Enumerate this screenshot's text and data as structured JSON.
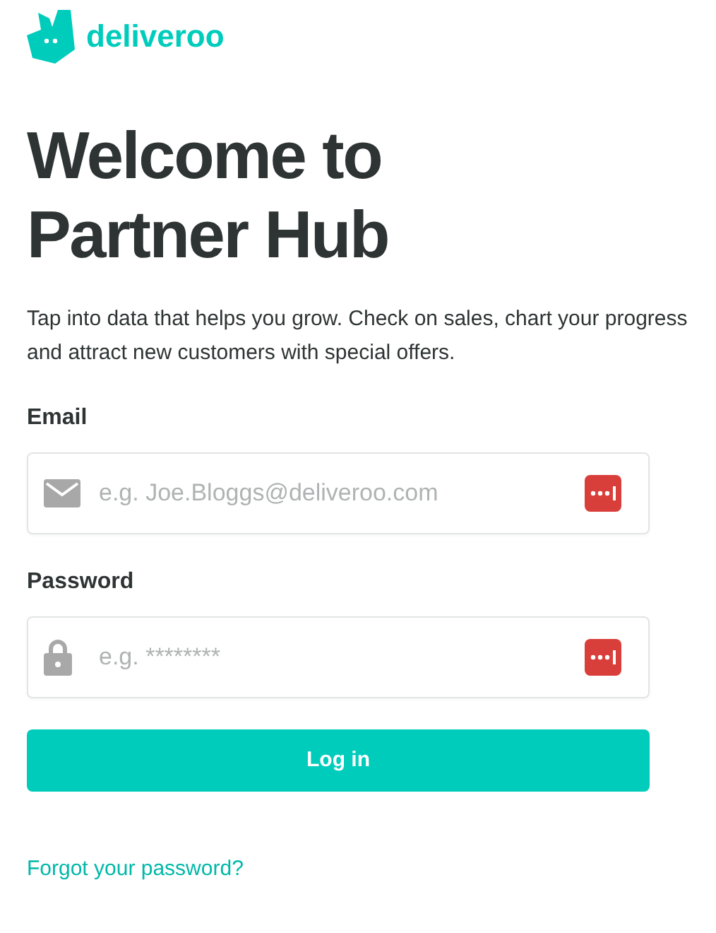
{
  "logo": {
    "wordmark": "deliveroo"
  },
  "heading": "Welcome to Partner Hub",
  "intro": "Tap into data that helps you grow. Check on sales, chart your progress and attract new customers with special offers.",
  "fields": [
    {
      "kind": "email",
      "label": "Email",
      "placeholder": "e.g. Joe.Bloggs@deliveroo.com"
    },
    {
      "kind": "password",
      "label": "Password",
      "placeholder": "e.g. ********"
    }
  ],
  "login_button": "Log in",
  "forgot_link": "Forgot your password?"
}
